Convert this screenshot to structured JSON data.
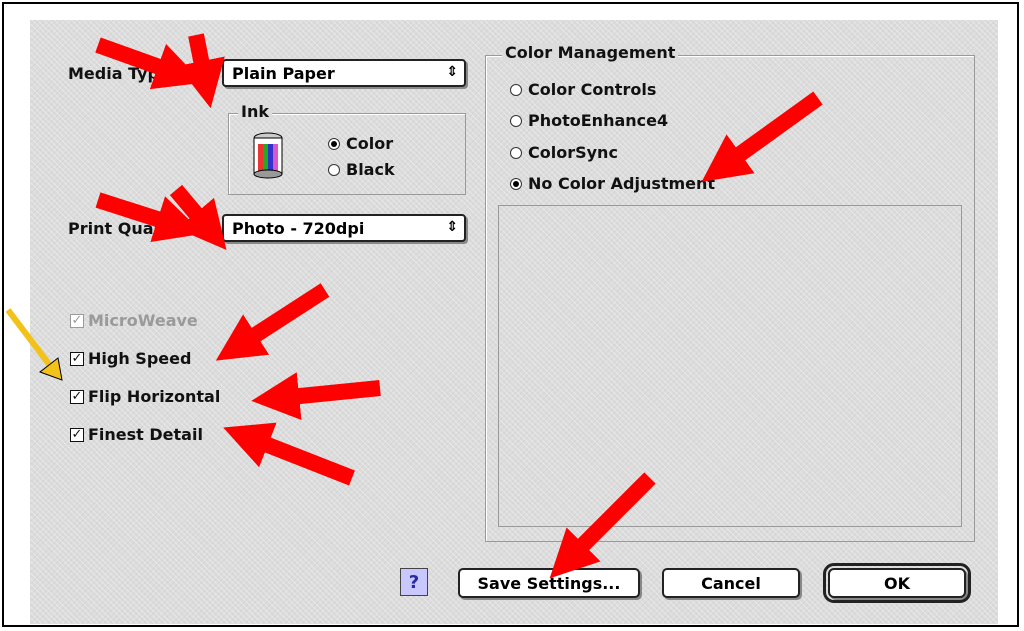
{
  "media_type": {
    "label": "Media Typ",
    "value": "Plain Paper"
  },
  "ink": {
    "title": "Ink",
    "options": [
      {
        "label": "Color",
        "selected": true
      },
      {
        "label": "Black",
        "selected": false
      }
    ]
  },
  "print_quality": {
    "label": "Print Qual",
    "value": "Photo - 720dpi"
  },
  "checkboxes": [
    {
      "label": "MicroWeave",
      "checked": true,
      "disabled": true
    },
    {
      "label": "High Speed",
      "checked": true,
      "disabled": false
    },
    {
      "label": "Flip Horizontal",
      "checked": true,
      "disabled": false
    },
    {
      "label": "Finest Detail",
      "checked": true,
      "disabled": false
    }
  ],
  "color_management": {
    "title": "Color Management",
    "options": [
      {
        "label": "Color Controls",
        "selected": false
      },
      {
        "label": "PhotoEnhance4",
        "selected": false
      },
      {
        "label": "ColorSync",
        "selected": false
      },
      {
        "label": "No Color Adjustment",
        "selected": true
      }
    ]
  },
  "buttons": {
    "help": "?",
    "save": "Save Settings...",
    "cancel": "Cancel",
    "ok": "OK"
  },
  "colors": {
    "panel": "#dcdcdc",
    "arrow_red": "#ff0000",
    "arrow_yellow": "#f2c21b",
    "help_bg": "#c8c8ff"
  },
  "icons": {
    "arrow_down": "⇕",
    "ink": "ink-cartridge-icon",
    "check": "✓"
  }
}
